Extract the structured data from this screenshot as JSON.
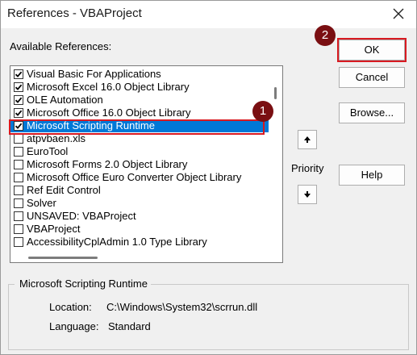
{
  "window": {
    "title": "References - VBAProject",
    "close_label": "Close"
  },
  "available_label": "Available References:",
  "references": [
    {
      "label": "Visual Basic For Applications",
      "checked": true,
      "selected": false
    },
    {
      "label": "Microsoft Excel 16.0 Object Library",
      "checked": true,
      "selected": false
    },
    {
      "label": "OLE Automation",
      "checked": true,
      "selected": false
    },
    {
      "label": "Microsoft Office 16.0 Object Library",
      "checked": true,
      "selected": false
    },
    {
      "label": "Microsoft Scripting Runtime",
      "checked": true,
      "selected": true
    },
    {
      "label": "atpvbaen.xls",
      "checked": false,
      "selected": false
    },
    {
      "label": "EuroTool",
      "checked": false,
      "selected": false
    },
    {
      "label": "Microsoft Forms 2.0 Object Library",
      "checked": false,
      "selected": false
    },
    {
      "label": "Microsoft Office Euro Converter Object Library",
      "checked": false,
      "selected": false
    },
    {
      "label": "Ref Edit Control",
      "checked": false,
      "selected": false
    },
    {
      "label": "Solver",
      "checked": false,
      "selected": false
    },
    {
      "label": "UNSAVED: VBAProject",
      "checked": false,
      "selected": false
    },
    {
      "label": "VBAProject",
      "checked": false,
      "selected": false
    },
    {
      "label": "AccessibilityCplAdmin 1.0 Type Library",
      "checked": false,
      "selected": false
    }
  ],
  "buttons": {
    "ok": "OK",
    "cancel": "Cancel",
    "browse": "Browse...",
    "help": "Help"
  },
  "priority_label": "Priority",
  "badges": {
    "one": "1",
    "two": "2"
  },
  "details": {
    "title": "Microsoft Scripting Runtime",
    "location_label": "Location:",
    "location_value": "C:\\Windows\\System32\\scrrun.dll",
    "language_label": "Language:",
    "language_value": "Standard"
  },
  "colors": {
    "selection": "#0078d7",
    "annotation_red": "#d81a21",
    "badge": "#7a0f12"
  }
}
